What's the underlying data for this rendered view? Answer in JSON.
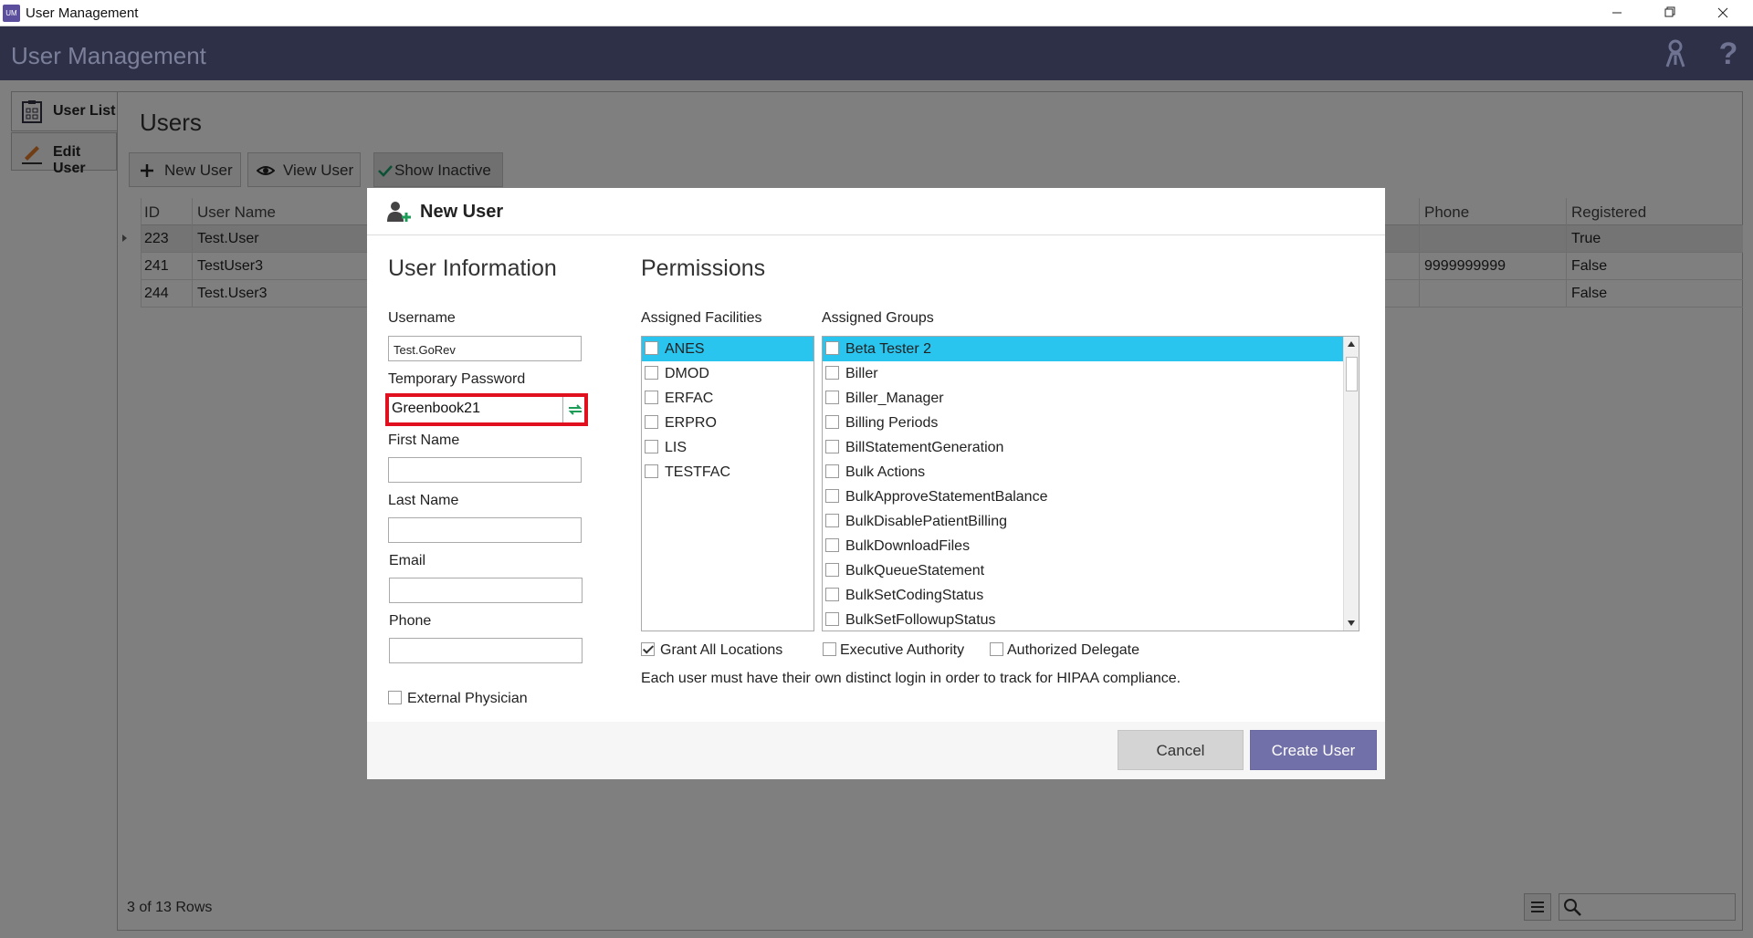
{
  "window": {
    "title": "User Management",
    "app_icon_text": "UM"
  },
  "app_header": {
    "title": "User Management",
    "help_icon_text": "?"
  },
  "side_tabs": [
    {
      "label": "User List"
    },
    {
      "label": "Edit User"
    }
  ],
  "users_page": {
    "title": "Users",
    "toolbar": {
      "new_user": "New User",
      "view_user": "View User",
      "show_inactive": "Show Inactive"
    },
    "columns": [
      "ID",
      "User Name",
      "Phone",
      "Registered"
    ],
    "rows": [
      {
        "id": "223",
        "user_name": "Test.User",
        "phone": "",
        "registered": "True"
      },
      {
        "id": "241",
        "user_name": "TestUser3",
        "phone": "9999999999",
        "registered": "False"
      },
      {
        "id": "244",
        "user_name": "Test.User3",
        "phone": "",
        "registered": "False"
      }
    ],
    "footer_rows": "3 of 13 Rows"
  },
  "dialog": {
    "title": "New User",
    "user_info": {
      "section_title": "User Information",
      "username_label": "Username",
      "username_value": "Test.GoRev",
      "temp_password_label": "Temporary Password",
      "temp_password_value": "Greenbook21",
      "first_name_label": "First Name",
      "first_name_value": "",
      "last_name_label": "Last Name",
      "last_name_value": "",
      "email_label": "Email",
      "email_value": "",
      "phone_label": "Phone",
      "phone_value": "",
      "external_physician_label": "External Physician",
      "external_physician_checked": false
    },
    "permissions": {
      "section_title": "Permissions",
      "facilities_label": "Assigned Facilities",
      "facilities": [
        {
          "label": "ANES",
          "checked": false,
          "selected": true
        },
        {
          "label": "DMOD",
          "checked": false,
          "selected": false
        },
        {
          "label": "ERFAC",
          "checked": false,
          "selected": false
        },
        {
          "label": "ERPRO",
          "checked": false,
          "selected": false
        },
        {
          "label": "LIS",
          "checked": false,
          "selected": false
        },
        {
          "label": "TESTFAC",
          "checked": false,
          "selected": false
        }
      ],
      "groups_label": "Assigned Groups",
      "groups": [
        {
          "label": "Beta Tester 2",
          "checked": false,
          "selected": true
        },
        {
          "label": "Biller",
          "checked": false,
          "selected": false
        },
        {
          "label": "Biller_Manager",
          "checked": false,
          "selected": false
        },
        {
          "label": "Billing Periods",
          "checked": false,
          "selected": false
        },
        {
          "label": "BillStatementGeneration",
          "checked": false,
          "selected": false
        },
        {
          "label": "Bulk Actions",
          "checked": false,
          "selected": false
        },
        {
          "label": "BulkApproveStatementBalance",
          "checked": false,
          "selected": false
        },
        {
          "label": "BulkDisablePatientBilling",
          "checked": false,
          "selected": false
        },
        {
          "label": "BulkDownloadFiles",
          "checked": false,
          "selected": false
        },
        {
          "label": "BulkQueueStatement",
          "checked": false,
          "selected": false
        },
        {
          "label": "BulkSetCodingStatus",
          "checked": false,
          "selected": false
        },
        {
          "label": "BulkSetFollowupStatus",
          "checked": false,
          "selected": false
        }
      ],
      "grant_all_locations_label": "Grant All Locations",
      "grant_all_locations_checked": true,
      "executive_authority_label": "Executive Authority",
      "executive_authority_checked": false,
      "authorized_delegate_label": "Authorized Delegate",
      "authorized_delegate_checked": false,
      "hint": "Each user must have their own distinct login in order to track for HIPAA compliance."
    },
    "buttons": {
      "cancel": "Cancel",
      "create": "Create User"
    }
  },
  "colors": {
    "header_bg": "#2d3047",
    "accent_selection": "#29c5ef",
    "primary_button": "#7270a8",
    "highlight_border": "#e0101f"
  }
}
